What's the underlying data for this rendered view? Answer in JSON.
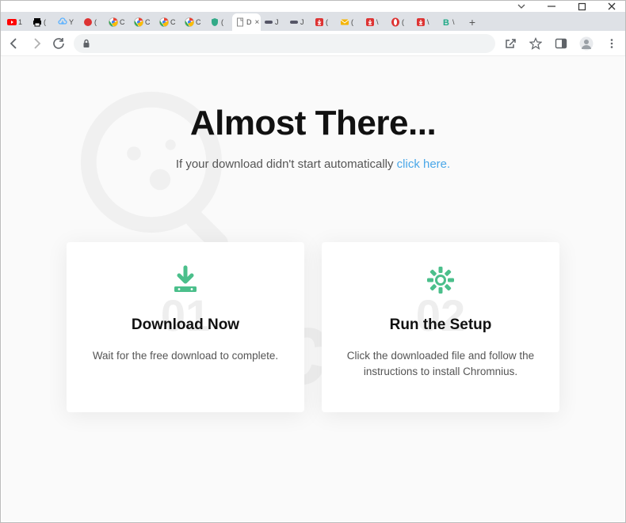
{
  "window": {},
  "tabs": [
    {
      "label": "1",
      "favicon": "youtube",
      "color": "#f00"
    },
    {
      "label": "(",
      "favicon": "printer",
      "color": "#000"
    },
    {
      "label": "Y",
      "favicon": "cloud",
      "color": "#5ab1ff"
    },
    {
      "label": "(",
      "favicon": "red-dot",
      "color": "#d33"
    },
    {
      "label": "C",
      "favicon": "chrome",
      "color": "#999"
    },
    {
      "label": "C",
      "favicon": "chrome",
      "color": "#999"
    },
    {
      "label": "C",
      "favicon": "chrome",
      "color": "#999"
    },
    {
      "label": "C",
      "favicon": "chrome",
      "color": "#999"
    },
    {
      "label": "(",
      "favicon": "shield",
      "color": "#3a8"
    },
    {
      "label": "D",
      "favicon": "page",
      "color": "#999",
      "active": true
    },
    {
      "label": "J",
      "favicon": "pill",
      "color": "#556"
    },
    {
      "label": "J",
      "favicon": "pill",
      "color": "#556"
    },
    {
      "label": "(",
      "favicon": "dl-red",
      "color": "#d33"
    },
    {
      "label": "(",
      "favicon": "mail",
      "color": "#f5b400"
    },
    {
      "label": "\\",
      "favicon": "dl-red",
      "color": "#d33"
    },
    {
      "label": "(",
      "favicon": "opera",
      "color": "#d33"
    },
    {
      "label": "\\",
      "favicon": "dl-red",
      "color": "#d33"
    },
    {
      "label": "\\",
      "favicon": "b-green",
      "color": "#2a8"
    }
  ],
  "page": {
    "headline": "Almost There...",
    "subline_text": "If your download didn't start automatically ",
    "subline_link": "click here.",
    "cards": [
      {
        "num": "01",
        "title": "Download Now",
        "body": "Wait for the free download to complete.",
        "icon": "download"
      },
      {
        "num": "02",
        "title": "Run the Setup",
        "body": "Click the downloaded file and follow the instructions to install Chromnius.",
        "icon": "gear"
      }
    ]
  },
  "watermark": "risk.com"
}
